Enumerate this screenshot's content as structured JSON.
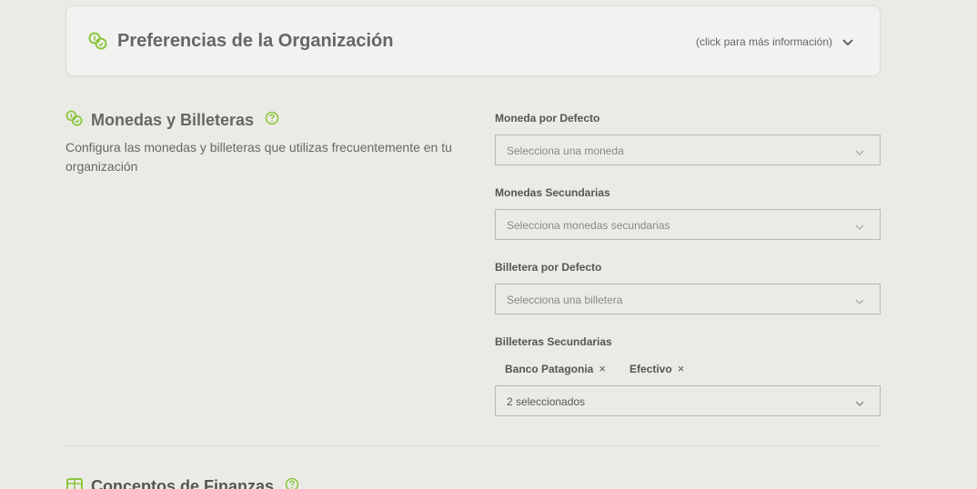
{
  "org_card": {
    "title": "Preferencias de la Organización",
    "hint": "(click para más información)",
    "icons": [
      "coins-icon",
      "chevron-down-icon"
    ]
  },
  "monedas_section": {
    "title": "Monedas y Billeteras",
    "description": "Configura las monedas y billeteras que utilizas frecuentemente en tu organización",
    "icons": [
      "coins-icon",
      "help-icon"
    ]
  },
  "fields": {
    "default_currency": {
      "label": "Moneda por Defecto",
      "placeholder": "Selecciona una moneda"
    },
    "secondary_currencies": {
      "label": "Monedas Secundarias",
      "placeholder": "Selecciona monedas secundarias"
    },
    "default_wallet": {
      "label": "Billetera por Defecto",
      "placeholder": "Selecciona una billetera"
    },
    "secondary_wallets": {
      "label": "Billeteras Secundarias",
      "tags": [
        "Banco Patagonia",
        "Efectivo"
      ],
      "remove_symbol": "×",
      "value": "2 seleccionados"
    }
  },
  "next_section": {
    "title": "Conceptos de Finanzas",
    "icons": [
      "box-icon",
      "help-icon"
    ]
  },
  "colors": {
    "accent": "#8cc63f",
    "background": "#ebebe6",
    "card": "#f2f2f0",
    "border": "#b9b9b4",
    "text": "#666666"
  }
}
